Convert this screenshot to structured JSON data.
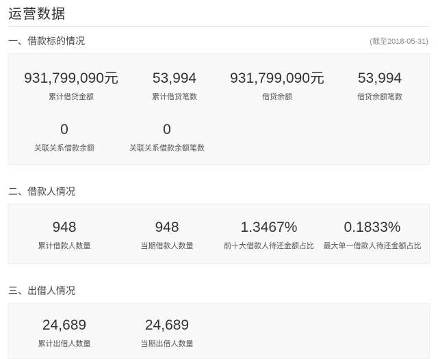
{
  "page": {
    "title": "运营数据"
  },
  "sections": [
    {
      "heading": "一、借款标的情况",
      "note": "(截至2018-05-31)",
      "stats": [
        {
          "value": "931,799,090元",
          "label": "累计借贷金额"
        },
        {
          "value": "53,994",
          "label": "累计借贷笔数"
        },
        {
          "value": "931,799,090元",
          "label": "借贷余额"
        },
        {
          "value": "53,994",
          "label": "借贷余额笔数"
        },
        {
          "value": "0",
          "label": "关联关系借款余额"
        },
        {
          "value": "0",
          "label": "关联关系借款余额笔数"
        }
      ]
    },
    {
      "heading": "二、借款人情况",
      "stats": [
        {
          "value": "948",
          "label": "累计借款人数量"
        },
        {
          "value": "948",
          "label": "当期借款人数量"
        },
        {
          "value": "1.3467%",
          "label": "前十大借款人待还金额占比"
        },
        {
          "value": "0.1833%",
          "label": "最大单一借款人待还金额占比"
        }
      ]
    },
    {
      "heading": "三、出借人情况",
      "stats": [
        {
          "value": "24,689",
          "label": "累计出借人数量"
        },
        {
          "value": "24,689",
          "label": "当期出借人数量"
        }
      ]
    }
  ]
}
